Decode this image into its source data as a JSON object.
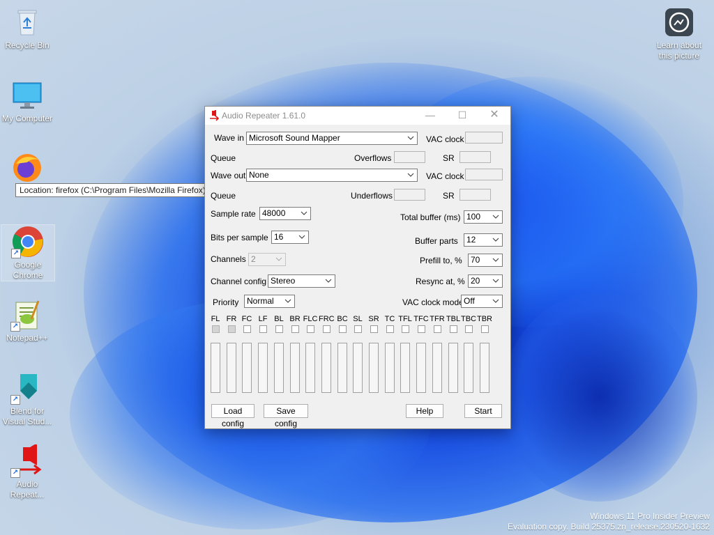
{
  "desktop": {
    "icons": [
      {
        "label": "Recycle Bin"
      },
      {
        "label": "My Computer"
      },
      {
        "label": "Firefox"
      },
      {
        "label": "Google Chrome"
      },
      {
        "label": "Notepad++"
      },
      {
        "label": "Blend for Visual Stud..."
      },
      {
        "label": "Audio Repeat..."
      },
      {
        "label": "Learn about this picture"
      }
    ],
    "tooltip": "Location: firefox (C:\\Program Files\\Mozilla Firefox)",
    "watermark_line1": "Windows 11 Pro Insider Preview",
    "watermark_line2": "Evaluation copy. Build 25375.zn_release.230520-1632"
  },
  "window": {
    "title": "Audio Repeater 1.61.0",
    "wave_in_label": "Wave in",
    "wave_in_value": "Microsoft Sound Mapper",
    "vac_clock_label": "VAC clock",
    "queue_label": "Queue",
    "overflows_label": "Overflows",
    "sr_label": "SR",
    "wave_out_label": "Wave out",
    "wave_out_value": "None",
    "underflows_label": "Underflows",
    "sample_rate_label": "Sample rate",
    "sample_rate_value": "48000",
    "total_buffer_label": "Total buffer (ms)",
    "total_buffer_value": "100",
    "bits_label": "Bits per sample",
    "bits_value": "16",
    "buffer_parts_label": "Buffer parts",
    "buffer_parts_value": "12",
    "channels_label": "Channels",
    "channels_value": "2",
    "prefill_label": "Prefill to, %",
    "prefill_value": "70",
    "channel_config_label": "Channel config",
    "channel_config_value": "Stereo",
    "resync_label": "Resync at, %",
    "resync_value": "20",
    "priority_label": "Priority",
    "priority_value": "Normal",
    "vac_clock_mode_label": "VAC clock mode",
    "vac_clock_mode_value": "Off",
    "channels_list": [
      "FL",
      "FR",
      "FC",
      "LF",
      "BL",
      "BR",
      "FLC",
      "FRC",
      "BC",
      "SL",
      "SR",
      "TC",
      "TFL",
      "TFC",
      "TFR",
      "TBL",
      "TBC",
      "TBR"
    ],
    "channels_checked": [
      true,
      true,
      false,
      false,
      false,
      false,
      false,
      false,
      false,
      false,
      false,
      false,
      false,
      false,
      false,
      false,
      false,
      false
    ],
    "load_config": "Load config",
    "save_config": "Save config",
    "help": "Help",
    "start": "Start"
  },
  "colors": {
    "accent_red": "#e01515"
  }
}
